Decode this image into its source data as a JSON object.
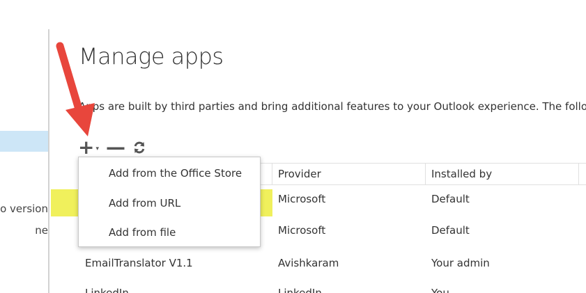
{
  "sidebar": {
    "version_text": "o version",
    "line_text": "ne"
  },
  "page": {
    "title": "Manage apps",
    "description": "Apps are built by third parties and bring additional features to your Outlook experience. The follo"
  },
  "toolbar": {
    "add_icon": "plus-icon",
    "remove_icon": "minus-icon",
    "refresh_icon": "refresh-icon"
  },
  "add_menu": {
    "items": [
      {
        "label": "Add from the Office Store"
      },
      {
        "label": "Add from URL"
      },
      {
        "label": "Add from file"
      }
    ]
  },
  "table": {
    "columns": [
      "Provider",
      "Installed by"
    ],
    "rows": [
      {
        "name": "",
        "provider": "Microsoft",
        "installed_by": "Default"
      },
      {
        "name": "",
        "provider": "Microsoft",
        "installed_by": "Default"
      },
      {
        "name": "EmailTranslator V1.1",
        "provider": "Avishkaram",
        "installed_by": "Your admin"
      },
      {
        "name": "LinkedIn",
        "provider": "LinkedIn",
        "installed_by": "You"
      }
    ]
  },
  "colors": {
    "highlight": "#eeee4a",
    "arrow": "#e8463c",
    "sidebar_selected": "#cde6f7"
  }
}
